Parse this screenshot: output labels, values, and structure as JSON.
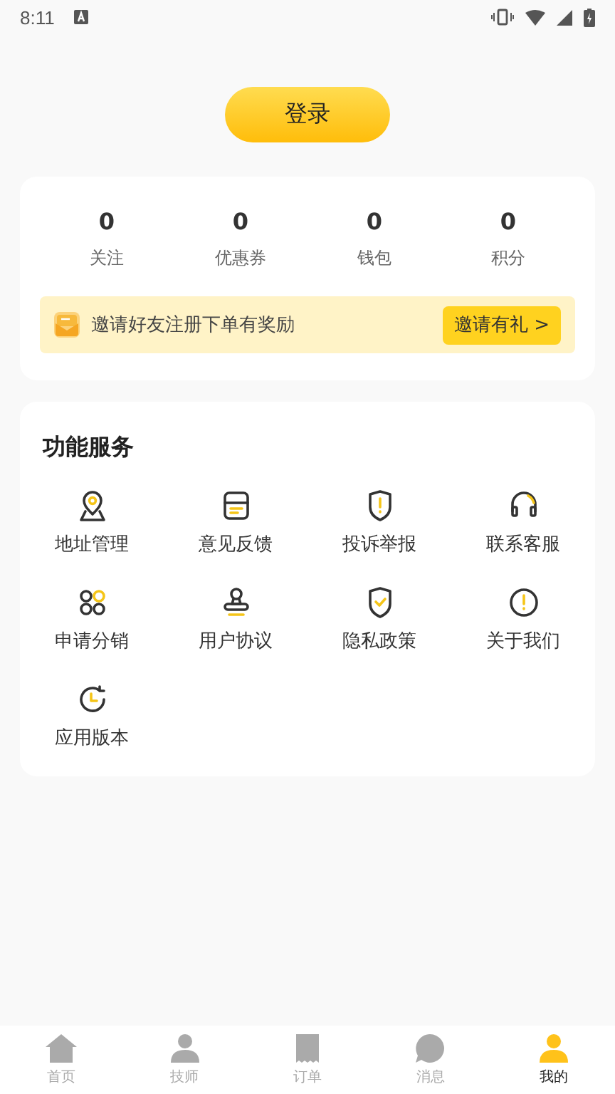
{
  "status_bar": {
    "time": "8:11"
  },
  "login_button": "登录",
  "stats": [
    {
      "value": "0",
      "label": "关注"
    },
    {
      "value": "0",
      "label": "优惠券"
    },
    {
      "value": "0",
      "label": "钱包"
    },
    {
      "value": "0",
      "label": "积分"
    }
  ],
  "invite_banner": {
    "text": "邀请好友注册下单有奖励",
    "button": "邀请有礼",
    "arrow": ">"
  },
  "services": {
    "title": "功能服务",
    "items": [
      {
        "label": "地址管理"
      },
      {
        "label": "意见反馈"
      },
      {
        "label": "投诉举报"
      },
      {
        "label": "联系客服"
      },
      {
        "label": "申请分销"
      },
      {
        "label": "用户协议"
      },
      {
        "label": "隐私政策"
      },
      {
        "label": "关于我们"
      },
      {
        "label": "应用版本"
      }
    ]
  },
  "bottom_nav": [
    {
      "label": "首页",
      "selected": false
    },
    {
      "label": "技师",
      "selected": false
    },
    {
      "label": "订单",
      "selected": false
    },
    {
      "label": "消息",
      "selected": false
    },
    {
      "label": "我的",
      "selected": true
    }
  ]
}
